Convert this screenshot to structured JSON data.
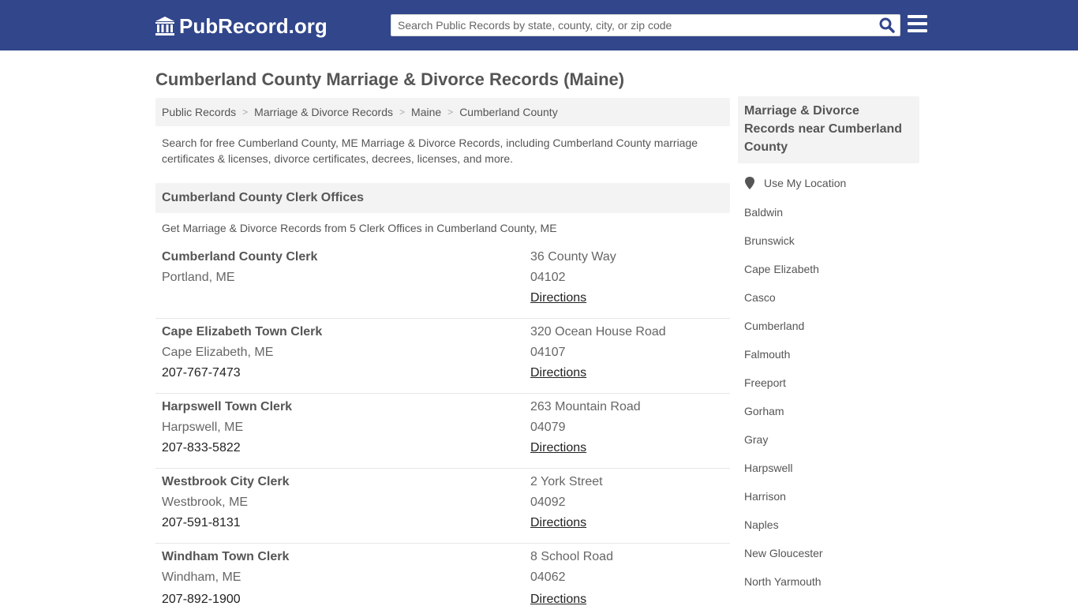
{
  "header": {
    "logo_text": "PubRecord.org",
    "search_placeholder": "Search Public Records by state, county, city, or zip code",
    "brand_color": "#31468b"
  },
  "page_title": "Cumberland County Marriage & Divorce Records (Maine)",
  "breadcrumb": [
    "Public Records",
    "Marriage & Divorce Records",
    "Maine",
    "Cumberland County"
  ],
  "intro": "Search for free Cumberland County, ME Marriage & Divorce Records, including Cumberland County marriage certificates & licenses, divorce certificates, decrees, licenses, and more.",
  "section": {
    "title": "Cumberland County Clerk Offices",
    "subtitle": "Get Marriage & Divorce Records from 5 Clerk Offices in Cumberland County, ME"
  },
  "offices": [
    {
      "name": "Cumberland County Clerk",
      "city": "Portland, ME",
      "phone": "",
      "street": "36 County Way",
      "zip": "04102",
      "directions": "Directions"
    },
    {
      "name": "Cape Elizabeth Town Clerk",
      "city": "Cape Elizabeth, ME",
      "phone": "207-767-7473",
      "street": "320 Ocean House Road",
      "zip": "04107",
      "directions": "Directions"
    },
    {
      "name": "Harpswell Town Clerk",
      "city": "Harpswell, ME",
      "phone": "207-833-5822",
      "street": "263 Mountain Road",
      "zip": "04079",
      "directions": "Directions"
    },
    {
      "name": "Westbrook City Clerk",
      "city": "Westbrook, ME",
      "phone": "207-591-8131",
      "street": "2 York Street",
      "zip": "04092",
      "directions": "Directions"
    },
    {
      "name": "Windham Town Clerk",
      "city": "Windham, ME",
      "phone": "207-892-1900",
      "street": "8 School Road",
      "zip": "04062",
      "directions": "Directions"
    }
  ],
  "sidebar": {
    "title": "Marriage & Divorce Records near Cumberland County",
    "use_location": "Use My Location",
    "places": [
      "Baldwin",
      "Brunswick",
      "Cape Elizabeth",
      "Casco",
      "Cumberland",
      "Falmouth",
      "Freeport",
      "Gorham",
      "Gray",
      "Harpswell",
      "Harrison",
      "Naples",
      "New Gloucester",
      "North Yarmouth"
    ]
  }
}
